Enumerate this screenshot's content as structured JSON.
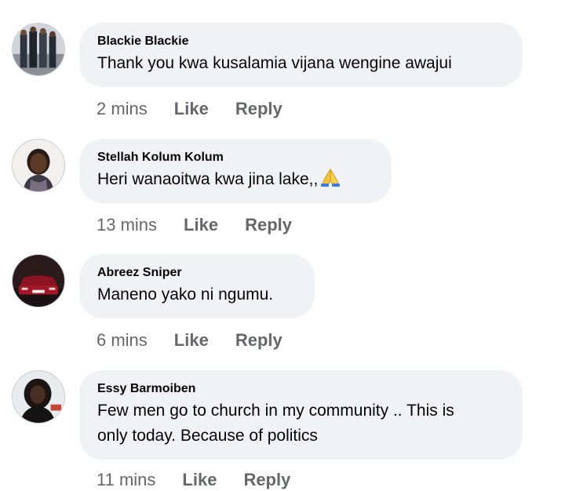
{
  "comments": [
    {
      "author": "Blackie Blackie",
      "text": "Thank you kwa kusalamia vijana wengine awajui",
      "time": "2 mins",
      "like": "Like",
      "reply": "Reply"
    },
    {
      "author": "Stellah Kolum Kolum",
      "text": "Heri wanaoitwa kwa jina lake,,",
      "time": "13 mins",
      "like": "Like",
      "reply": "Reply"
    },
    {
      "author": "Abreez Sniper",
      "text": "Maneno yako ni ngumu.",
      "time": "6 mins",
      "like": "Like",
      "reply": "Reply"
    },
    {
      "author": "Essy Barmoiben",
      "text_line1": "Few men go to church in my community .. This is",
      "text_line2": "only today. Because of politics",
      "time": "11 mins",
      "like": "Like",
      "reply": "Reply"
    }
  ],
  "icons": {
    "emoji": "folded-hands-emoji"
  },
  "colors": {
    "bubble": "#f0f2f5",
    "meta_text": "#65676b",
    "body_text": "#050505"
  }
}
